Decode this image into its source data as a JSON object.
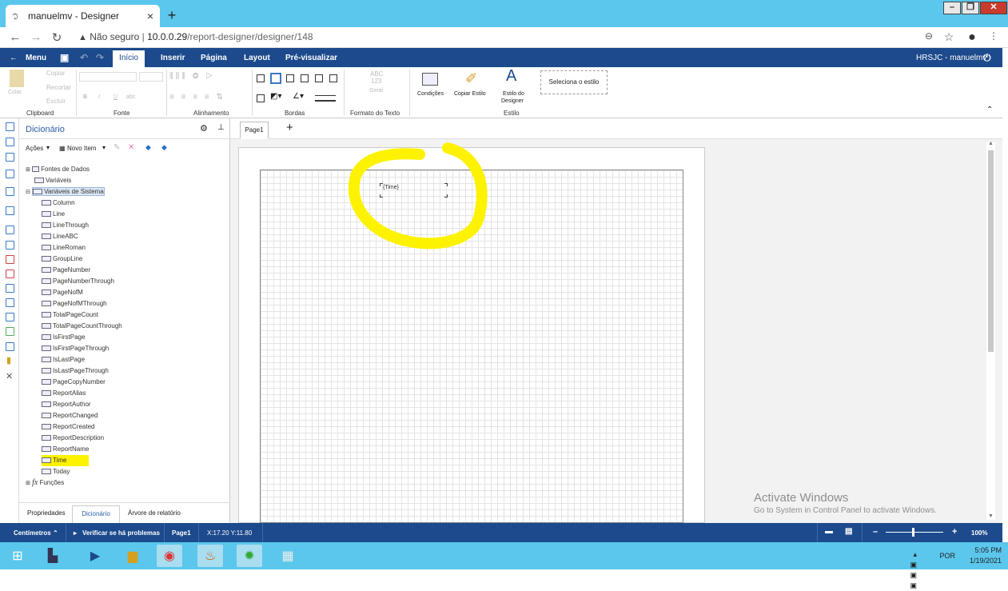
{
  "browser": {
    "tab_title": "manuelmv - Designer",
    "tab_close": "×",
    "new_tab": "+",
    "security": "Não seguro",
    "url_host": "10.0.0.29",
    "url_path": "/report-designer/designer/148",
    "win_min": "–",
    "win_max": "❐",
    "win_close": "✕"
  },
  "menubar": {
    "menu": "Menu",
    "tabs": [
      "Início",
      "Inserir",
      "Página",
      "Layout",
      "Pré-visualizar"
    ],
    "user": "HRSJC - manuelmv"
  },
  "ribbon": {
    "clipboard": {
      "copy": "Copiar",
      "cut": "Recortar",
      "paste": "Colar",
      "delete": "Excluir",
      "label": "Clipboard"
    },
    "font": {
      "bold": "B",
      "italic": "I",
      "underline": "U",
      "strike": "abc",
      "label": "Fonte"
    },
    "alignment": {
      "label": "Alinhamento"
    },
    "borders": {
      "label": "Bordas"
    },
    "text_format": {
      "sample_top": "ABC",
      "sample_mid": "123",
      "general": "Geral",
      "label": "Formato do Texto"
    },
    "style": {
      "conditions": "Condições",
      "copy_style": "Copiar Estilo",
      "designer_style_1": "Estilo do",
      "designer_style_2": "Designer",
      "select_style": "Seleciona o estilo",
      "label": "Estilo"
    }
  },
  "dictionary": {
    "title": "Dicionário",
    "actions": "Ações",
    "new_item": "Novo Item",
    "tree": {
      "data_sources": "Fontes de Dados",
      "variables": "Variáveis",
      "system_variables": "Variáveis de Sistema",
      "items": [
        "Column",
        "Line",
        "LineThrough",
        "LineABC",
        "LineRoman",
        "GroupLine",
        "PageNumber",
        "PageNumberThrough",
        "PageNofM",
        "PageNofMThrough",
        "TotalPageCount",
        "TotalPageCountThrough",
        "IsFirstPage",
        "IsFirstPageThrough",
        "IsLastPage",
        "IsLastPageThrough",
        "PageCopyNumber",
        "ReportAlias",
        "ReportAuthor",
        "ReportChanged",
        "ReportCreated",
        "ReportDescription",
        "ReportName",
        "Time",
        "Today"
      ],
      "functions": "Funções",
      "fx": "fx"
    },
    "footer_tabs": [
      "Propriedades",
      "Dicionário",
      "Árvore de relatório"
    ]
  },
  "page": {
    "tab": "Page1",
    "add": "+",
    "time_field": "{Time}"
  },
  "watermark": {
    "line1": "Activate Windows",
    "line2": "Go to System in Control Panel to activate Windows."
  },
  "status": {
    "units": "Centímetros",
    "check": "Verificar se há problemas",
    "page": "Page1",
    "coords": "X:17.20 Y:11.80",
    "zoom": "100%",
    "minus": "–",
    "plus": "+"
  },
  "taskbar": {
    "lang": "POR",
    "time": "5:05 PM",
    "date": "1/19/2021"
  },
  "colors": {
    "accent": "#1c4a8c",
    "chrome": "#5bc7ec",
    "highlight": "#fdf200"
  }
}
